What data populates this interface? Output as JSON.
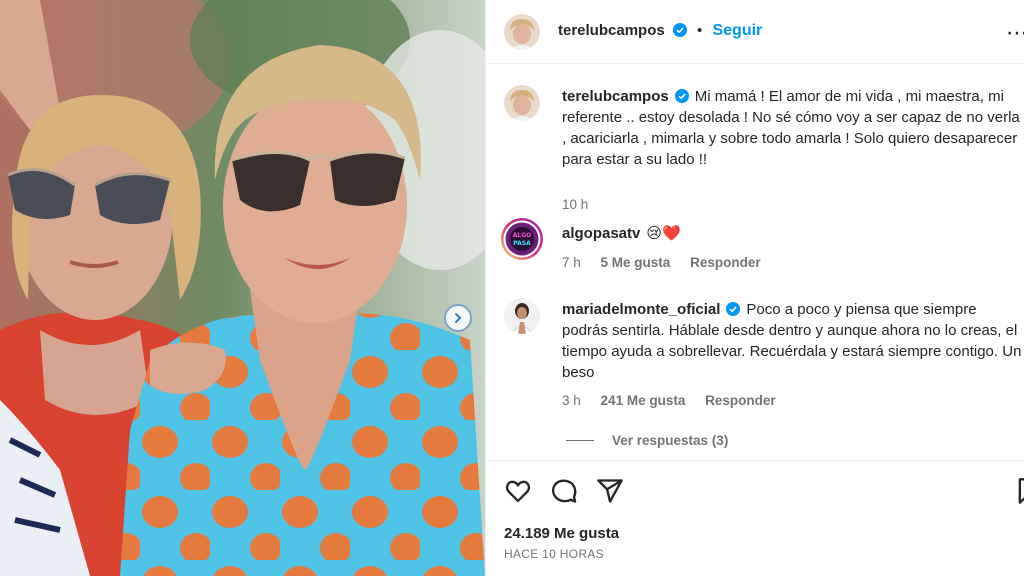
{
  "post": {
    "author": "terelubcampos",
    "follow_label": "Seguir",
    "separator": "•",
    "caption": "Mi mamá ! El amor de mi vida , mi maestra, mi referente .. estoy desolada ! No sé cómo voy a ser capaz de no verla , acariciarla , mimarla y sobre todo amarla ! Solo quiero desaparecer para estar a su lado !!",
    "caption_time": "10 h",
    "likes": "24.189 Me gusta",
    "posted_ago": "HACE 10 HORAS"
  },
  "comments": [
    {
      "username": "algopasatv",
      "text": "😢❤️",
      "time": "7 h",
      "likes": "5 Me gusta",
      "reply_label": "Responder",
      "verified": false
    },
    {
      "username": "mariadelmonte_oficial",
      "text": "Poco a poco y piensa que siempre podrás sentirla. Háblale desde dentro y aunque ahora no lo creas, el tiempo ayuda a sobrellevar. Recuérdala y estará siempre contigo. Un beso",
      "time": "3 h",
      "likes": "241 Me gusta",
      "reply_label": "Responder",
      "verified": true,
      "view_replies": "Ver respuestas (3)"
    }
  ],
  "icons": {
    "verified": "verified-badge-icon",
    "like": "heart-icon",
    "comment": "comment-bubble-icon",
    "share": "paper-plane-icon",
    "save": "bookmark-icon",
    "next": "chevron-right-icon",
    "more": "more-options-icon"
  },
  "colors": {
    "link_blue": "#0095f6",
    "verified_blue": "#0095f6",
    "muted": "#737373",
    "text": "#262626"
  }
}
